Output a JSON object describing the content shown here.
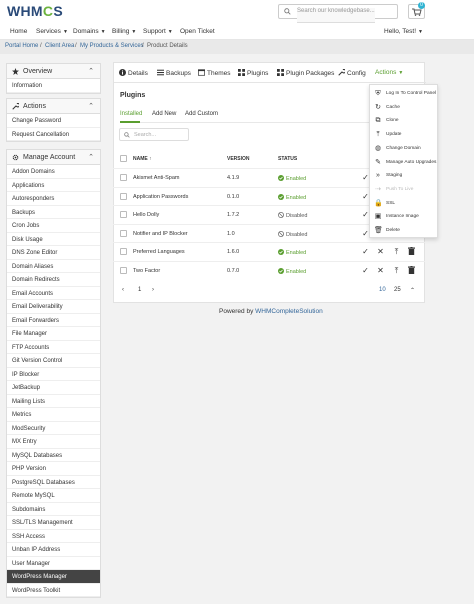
{
  "brand": {
    "logo_pre": "WHM",
    "logo_o": "C",
    "logo_post": "S"
  },
  "search": {
    "placeholder": "Search our knowledgebase..."
  },
  "cart": {
    "count": "0"
  },
  "nav": {
    "items": [
      "Home",
      "Services",
      "Domains",
      "Billing",
      "Support",
      "Open Ticket"
    ],
    "user": "Hello, Test!"
  },
  "breadcrumb": [
    "Portal Home",
    "Client Area",
    "My Products & Services",
    "Product Details"
  ],
  "overview": {
    "title": "Overview",
    "items": [
      "Information"
    ]
  },
  "actions_panel": {
    "title": "Actions",
    "items": [
      "Change Password",
      "Request Cancellation"
    ]
  },
  "manage": {
    "title": "Manage Account",
    "items": [
      "Addon Domains",
      "Applications",
      "Autoresponders",
      "Backups",
      "Cron Jobs",
      "Disk Usage",
      "DNS Zone Editor",
      "Domain Aliases",
      "Domain Redirects",
      "Email Accounts",
      "Email Deliverability",
      "Email Forwarders",
      "File Manager",
      "FTP Accounts",
      "Git Version Control",
      "IP Blocker",
      "JetBackup",
      "Mailing Lists",
      "Metrics",
      "ModSecurity",
      "MX Entry",
      "MySQL Databases",
      "PHP Version",
      "PostgreSQL Databases",
      "Remote MySQL",
      "Subdomains",
      "SSL/TLS Management",
      "SSH Access",
      "Unban IP Address",
      "User Manager",
      "WordPress Manager",
      "WordPress Toolkit"
    ],
    "active_index": 30
  },
  "tabs": [
    "Details",
    "Backups",
    "Themes",
    "Plugins",
    "Plugin Packages",
    "Config",
    "Actions"
  ],
  "plugins": {
    "title": "Plugins",
    "subtabs": [
      "Installed",
      "Add New",
      "Add Custom"
    ],
    "search_placeholder": "Search...",
    "headers": {
      "name": "NAME",
      "version": "VERSION",
      "status": "STATUS"
    },
    "rows": [
      {
        "name": "Akismet Anti-Spam",
        "version": "4.1.9",
        "status": "Enabled"
      },
      {
        "name": "Application Passwords",
        "version": "0.1.0",
        "status": "Enabled"
      },
      {
        "name": "Hello Dolly",
        "version": "1.7.2",
        "status": "Disabled"
      },
      {
        "name": "Notifier and IP Blocker",
        "version": "1.0",
        "status": "Disabled"
      },
      {
        "name": "Preferred Languages",
        "version": "1.6.0",
        "status": "Enabled"
      },
      {
        "name": "Two Factor",
        "version": "0.7.0",
        "status": "Enabled"
      }
    ],
    "pagination": {
      "page": "1",
      "per_page_a": "10",
      "per_page_b": "25"
    }
  },
  "actions_menu": [
    {
      "label": "Log In To Control Panel",
      "icon": "shield-icon",
      "dim": false
    },
    {
      "label": "Cache",
      "icon": "refresh-icon",
      "dim": false
    },
    {
      "label": "Clone",
      "icon": "copy-icon",
      "dim": false
    },
    {
      "label": "Update",
      "icon": "upload-icon",
      "dim": false
    },
    {
      "label": "Change Domain",
      "icon": "globe-icon",
      "dim": false
    },
    {
      "label": "Manage Auto Upgrades",
      "icon": "pencil-icon",
      "dim": false
    },
    {
      "label": "Staging",
      "icon": "forward-icon",
      "dim": false
    },
    {
      "label": "Push To Live",
      "icon": "push-icon",
      "dim": true
    },
    {
      "label": "SSL",
      "icon": "lock-icon",
      "dim": false
    },
    {
      "label": "Instance Image",
      "icon": "image-icon",
      "dim": false
    },
    {
      "label": "Delete",
      "icon": "trash-icon",
      "dim": false
    }
  ],
  "footer": {
    "prefix": "Powered by ",
    "link": "WHMCompleteSolution"
  },
  "colors": {
    "accent_green": "#5a9e2f",
    "brand_blue": "#2a4a78",
    "active_item": "#444444"
  }
}
